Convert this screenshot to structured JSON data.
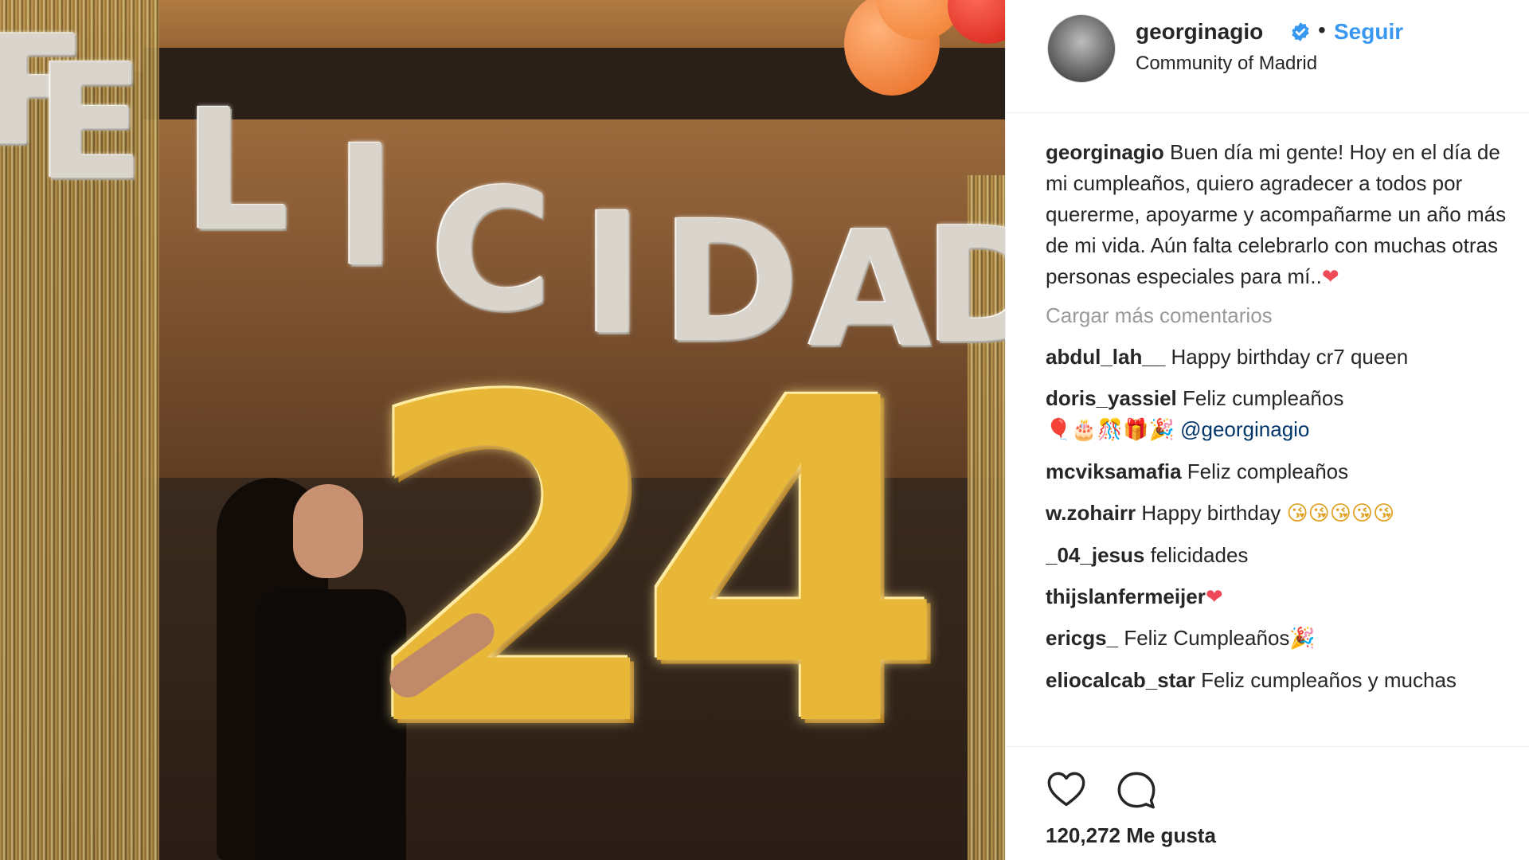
{
  "photo": {
    "balloon_banner_letters": [
      "F",
      "E",
      "L",
      "I",
      "C",
      "I",
      "D",
      "A",
      "D"
    ],
    "number_balloons": "24"
  },
  "post": {
    "username": "georginagio",
    "follow_label": "Seguir",
    "separator": "•",
    "location": "Community of Madrid",
    "caption": {
      "username": "georginagio",
      "text": "Buen día mi gente! Hoy en el día de mi cumpleaños, quiero agradecer a todos por quererme, apoyarme y acompañarme un año más de mi vida. Aún falta celebrarlo con muchas otras personas especiales para mí..",
      "emoji": "❤"
    },
    "load_more_label": "Cargar más comentarios",
    "comments": [
      {
        "username": "abdul_lah__",
        "text": "Happy birthday cr7 queen"
      },
      {
        "username": "doris_yassiel",
        "text": "Feliz cumpleaños",
        "emoji": "🎈🎂🎊🎁🎉",
        "mention": "@georginagio"
      },
      {
        "username": "mcviksamafia",
        "text": "Feliz compleaños"
      },
      {
        "username": "w.zohairr",
        "text": "Happy birthday",
        "emoji": "😘😘😘😘😘"
      },
      {
        "username": "_04_jesus",
        "text": "felicidades"
      },
      {
        "username": "thijslanfermeijer",
        "text": "",
        "emoji": "❤"
      },
      {
        "username": "ericgs_",
        "text": "Feliz Cumpleaños",
        "emoji": "🎉"
      },
      {
        "username": "eliocalcab_star",
        "text": "Feliz cumpleaños y muchas"
      }
    ],
    "likes_count": "120,272",
    "likes_label": "Me gusta"
  },
  "colors": {
    "accent": "#3897f0",
    "text": "#262626",
    "muted": "#999999",
    "border": "#efefef",
    "verified": "#3897f0",
    "mention": "#003569"
  },
  "icons": {
    "verified": "verified-badge-icon",
    "like": "heart-outline-icon",
    "comment": "speech-bubble-icon"
  }
}
